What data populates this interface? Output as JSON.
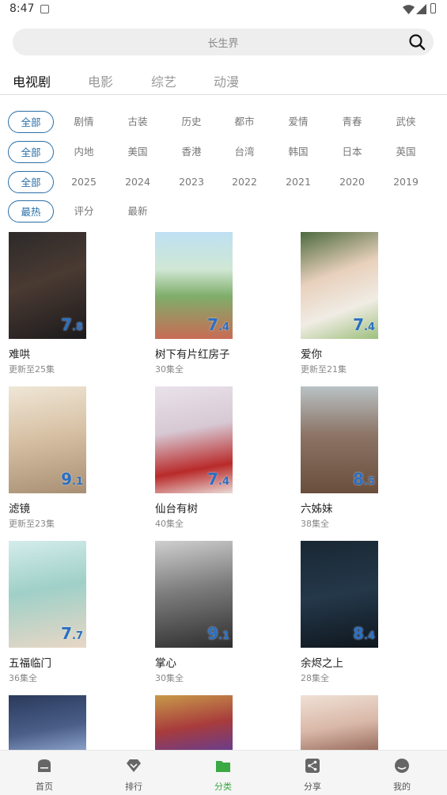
{
  "status_bar": {
    "time": "8:47"
  },
  "search": {
    "placeholder": "长生界"
  },
  "tabs": [
    {
      "label": "电视剧",
      "active": true
    },
    {
      "label": "电影"
    },
    {
      "label": "综艺"
    },
    {
      "label": "动漫"
    }
  ],
  "filters": {
    "genre": [
      "全部",
      "剧情",
      "古装",
      "历史",
      "都市",
      "爱情",
      "青春",
      "武侠"
    ],
    "region": [
      "全部",
      "内地",
      "美国",
      "香港",
      "台湾",
      "韩国",
      "日本",
      "英国"
    ],
    "year": [
      "全部",
      "2025",
      "2024",
      "2023",
      "2022",
      "2021",
      "2020",
      "2019"
    ],
    "sort": [
      "最热",
      "评分",
      "最新"
    ]
  },
  "items": [
    {
      "title": "难哄",
      "sub": "更新至25集",
      "score_main": "7",
      "score_dec": ".8"
    },
    {
      "title": "树下有片红房子",
      "sub": "30集全",
      "score_main": "7",
      "score_dec": ".4"
    },
    {
      "title": "爱你",
      "sub": "更新至21集",
      "score_main": "7",
      "score_dec": ".4"
    },
    {
      "title": "滤镜",
      "sub": "更新至23集",
      "score_main": "9",
      "score_dec": ".1"
    },
    {
      "title": "仙台有树",
      "sub": "40集全",
      "score_main": "7",
      "score_dec": ".4"
    },
    {
      "title": "六姊妹",
      "sub": "38集全",
      "score_main": "8",
      "score_dec": ".5"
    },
    {
      "title": "五福临门",
      "sub": "36集全",
      "score_main": "7",
      "score_dec": ".7"
    },
    {
      "title": "掌心",
      "sub": "30集全",
      "score_main": "9",
      "score_dec": ".1"
    },
    {
      "title": "余烬之上",
      "sub": "28集全",
      "score_main": "8",
      "score_dec": ".4"
    },
    {
      "title": "",
      "sub": "",
      "score_main": "",
      "score_dec": ""
    },
    {
      "title": "",
      "sub": "",
      "score_main": "",
      "score_dec": ""
    },
    {
      "title": "",
      "sub": "",
      "score_main": "",
      "score_dec": ""
    }
  ],
  "nav": [
    {
      "label": "首页",
      "icon": "home-icon"
    },
    {
      "label": "排行",
      "icon": "ranking-icon"
    },
    {
      "label": "分类",
      "icon": "category-icon",
      "active": true
    },
    {
      "label": "分享",
      "icon": "share-icon"
    },
    {
      "label": "我的",
      "icon": "profile-icon"
    }
  ],
  "colors": {
    "accent": "#2a6fa8",
    "score": "#2a70c4",
    "nav_active": "#3aa843"
  }
}
